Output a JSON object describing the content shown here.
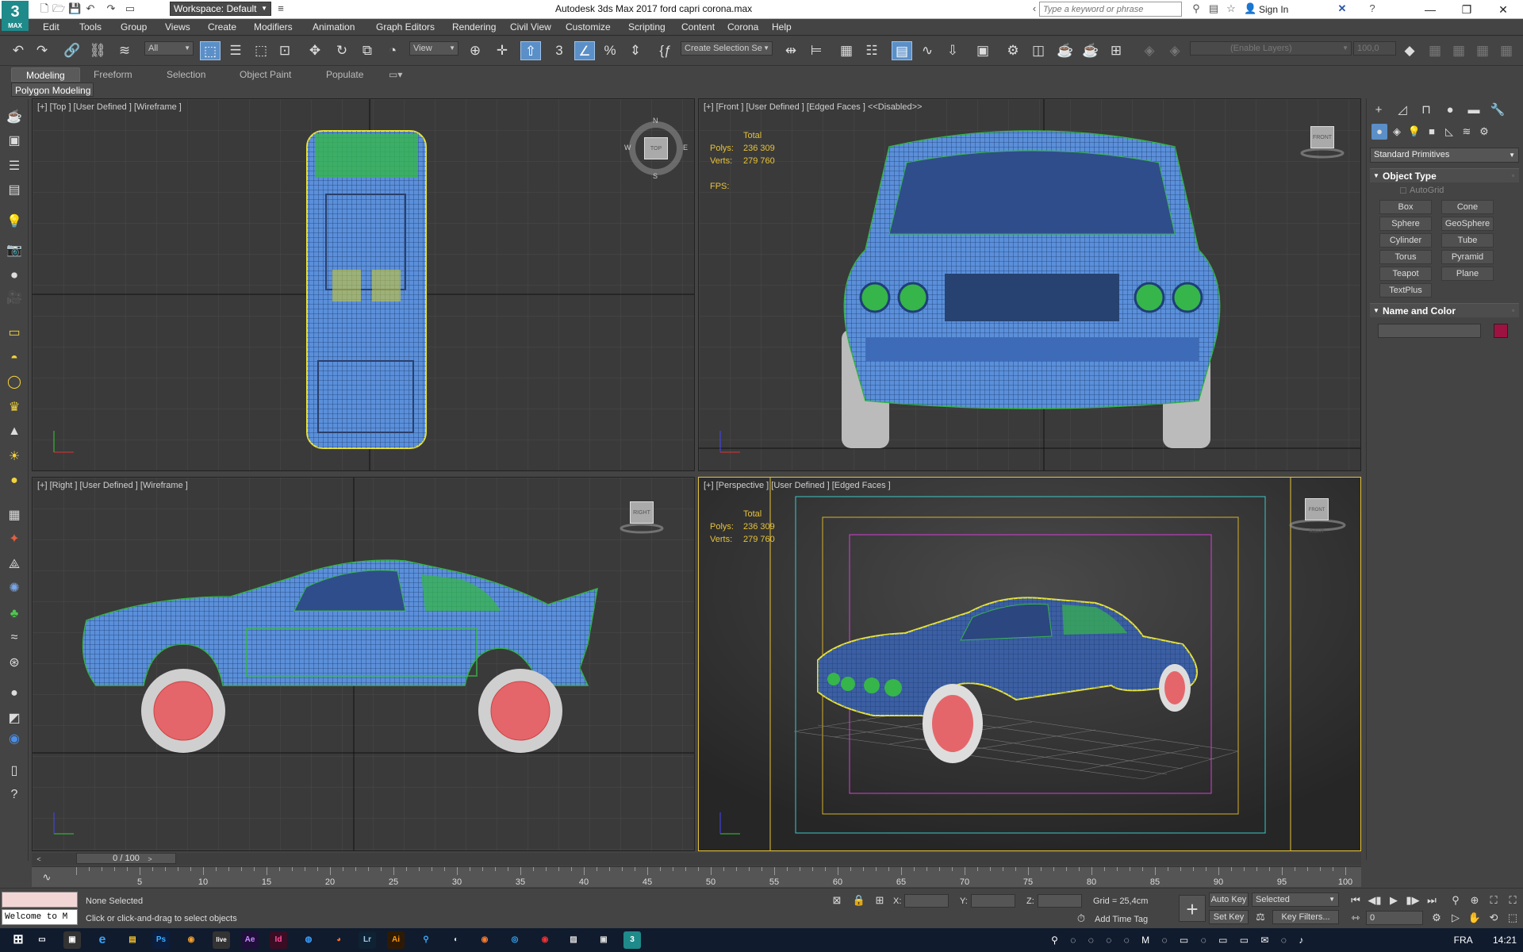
{
  "app": {
    "logo_number": "3",
    "logo_text": "MAX",
    "workspace": "Workspace: Default",
    "title": "Autodesk 3ds Max 2017     ford capri corona.max",
    "search_placeholder": "Type a keyword or phrase",
    "sign_in": "Sign In"
  },
  "menu": [
    "Edit",
    "Tools",
    "Group",
    "Views",
    "Create",
    "Modifiers",
    "Animation",
    "Graph Editors",
    "Rendering",
    "Civil View",
    "Customize",
    "Scripting",
    "Content",
    "Corona",
    "Help"
  ],
  "toolbar": {
    "filter_value": "All",
    "ref_coord_value": "View",
    "selection_set_value": "Create Selection Se",
    "layer_placeholder": "(Enable Layers)",
    "layer_value": "100,0"
  },
  "ribbon": {
    "tabs": [
      "Modeling",
      "Freeform",
      "Selection",
      "Object Paint",
      "Populate"
    ],
    "active_sub": "Polygon Modeling"
  },
  "viewports": {
    "top": {
      "label": "[+] [Top ] [User Defined ] [Wireframe ]",
      "cube": "TOP",
      "compass": [
        "N",
        "E",
        "S",
        "W"
      ]
    },
    "front": {
      "label": "[+] [Front ] [User Defined ] [Edged Faces ]  <<Disabled>>",
      "cube": "FRONT",
      "stats_total": "Total",
      "polys_label": "Polys:",
      "polys": "236 309",
      "verts_label": "Verts:",
      "verts": "279 760",
      "fps_label": "FPS:"
    },
    "right": {
      "label": "[+] [Right ] [User Defined ] [Wireframe ]",
      "cube": "RIGHT"
    },
    "perspective": {
      "label": "[+] [Perspective ] [User Defined ] [Edged Faces ]",
      "cube": "FRONT RIGHT",
      "stats_total": "Total",
      "polys_label": "Polys:",
      "polys": "236 309",
      "verts_label": "Verts:",
      "verts": "279 760"
    }
  },
  "command_panel": {
    "primitives_dropdown": "Standard Primitives",
    "object_type_header": "Object Type",
    "autogrid": "AutoGrid",
    "buttons": [
      "Box",
      "Cone",
      "Sphere",
      "GeoSphere",
      "Cylinder",
      "Tube",
      "Torus",
      "Pyramid",
      "Teapot",
      "Plane",
      "TextPlus"
    ],
    "name_color_header": "Name and Color",
    "object_color": "#9e1242"
  },
  "timeline": {
    "frame_display": "0 / 100",
    "ticks": [
      "5",
      "10",
      "15",
      "20",
      "25",
      "30",
      "35",
      "40",
      "45",
      "50",
      "55",
      "60",
      "65",
      "70",
      "75",
      "80",
      "85",
      "90",
      "95",
      "100"
    ]
  },
  "status": {
    "maxscript": "Welcome to M",
    "selection": "None Selected",
    "prompt": "Click or click-and-drag to select objects",
    "x_label": "X:",
    "y_label": "Y:",
    "z_label": "Z:",
    "grid": "Grid = 25,4cm",
    "add_time_tag": "Add Time Tag",
    "auto_key": "Auto Key",
    "set_key": "Set Key",
    "selected_dropdown": "Selected",
    "key_filters": "Key Filters...",
    "frame": "0"
  },
  "taskbar": {
    "lang": "FRA",
    "time": "14:21",
    "apps": [
      "Ps",
      "Lr",
      "Ae",
      "Id",
      "Ai",
      "Lr"
    ]
  },
  "colors": {
    "wire_blue": "#5b8fd9",
    "wire_green": "#36b54a",
    "wire_yellow": "#e6e23a",
    "wheel_red": "#e5666a",
    "active_border": "#e6c23a"
  }
}
